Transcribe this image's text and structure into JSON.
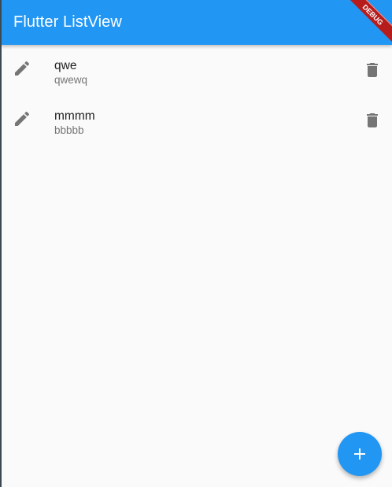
{
  "app_bar": {
    "title": "Flutter ListView",
    "debug_banner": "DEBUG"
  },
  "list": {
    "items": [
      {
        "title": "qwe",
        "subtitle": "qwewq"
      },
      {
        "title": "mmmm",
        "subtitle": "bbbbb"
      }
    ]
  },
  "fab": {
    "icon": "add-icon"
  },
  "colors": {
    "primary": "#2196f3",
    "background": "#fafafa",
    "icon_grey": "#757575",
    "debug_red": "#b71c1c"
  }
}
